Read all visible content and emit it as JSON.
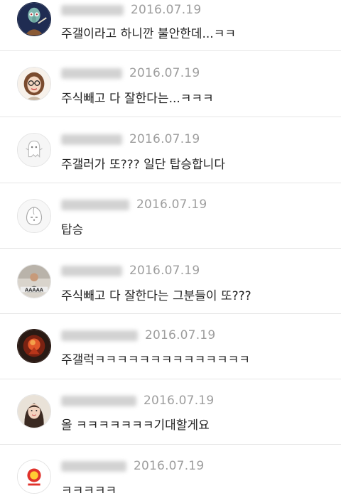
{
  "comments": [
    {
      "date": "2016.07.19",
      "text": "주갤이라고 하니깐 불안한데...ㅋㅋ",
      "avatar": "squidward-avatar-icon"
    },
    {
      "date": "2016.07.19",
      "text": "주식빼고 다 잘한다는...ㅋㅋㅋ",
      "avatar": "glasses-girl-avatar-icon"
    },
    {
      "date": "2016.07.19",
      "text": "주갤러가 또??? 일단 탑승합니다",
      "avatar": "ghost-avatar-icon"
    },
    {
      "date": "2016.07.19",
      "text": "탑승",
      "avatar": "peach-avatar-icon"
    },
    {
      "date": "2016.07.19",
      "text": "주식빼고 다 잘한다는 그분들이 또???",
      "avatar": "man-photo-avatar-icon"
    },
    {
      "date": "2016.07.19",
      "text": "주갤럭ㅋㅋㅋㅋㅋㅋㅋㅋㅋㅋㅋㅋㅋㅋ",
      "avatar": "fire-figure-avatar-icon"
    },
    {
      "date": "2016.07.19",
      "text": "올 ㅋㅋㅋㅋㅋㅋㅋ기대할게요",
      "avatar": "woman-photo-avatar-icon"
    },
    {
      "date": "2016.07.19",
      "text": "ㅋㅋㅋㅋㅋ",
      "avatar": "red-badge-avatar-icon"
    }
  ]
}
